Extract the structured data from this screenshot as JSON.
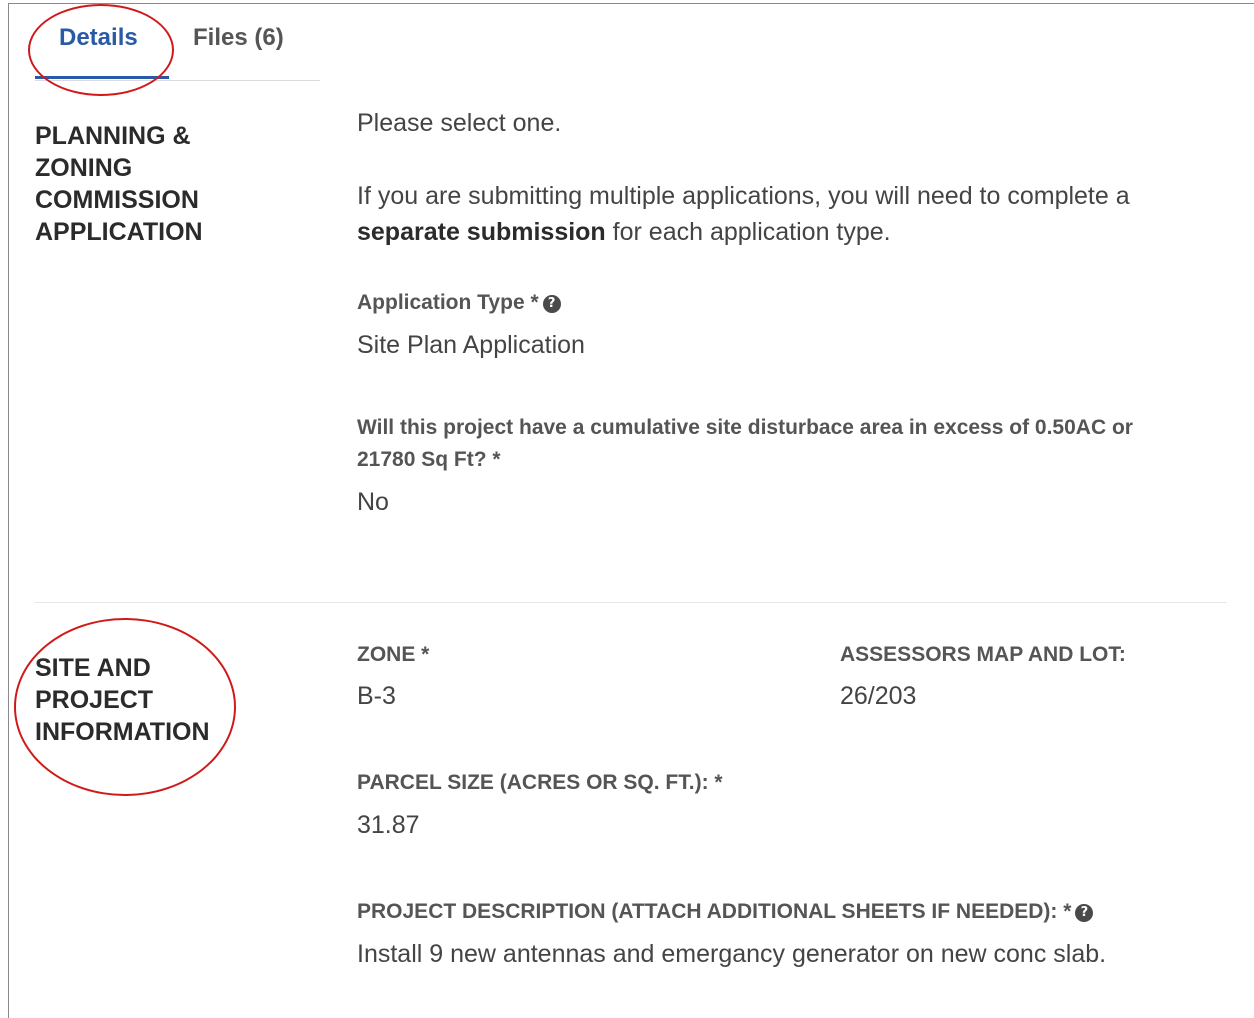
{
  "tabs": {
    "details": "Details",
    "files": "Files (6)"
  },
  "section1": {
    "title": "PLANNING &\nZONING\nCOMMISSION\nAPPLICATION",
    "intro": "Please select one.",
    "note_pre": "If you are submitting multiple applications, you will need to complete a",
    "note_bold": "separate submission",
    "note_post": " for each application type.",
    "app_type_label": "Application Type *",
    "app_type_value": "Site Plan Application",
    "disturb_label_1": "Will this project have a cumulative site disturbace area in excess of 0.50AC or",
    "disturb_label_2": "21780 Sq Ft? *",
    "disturb_value": "No"
  },
  "section2": {
    "title": "SITE AND\nPROJECT\nINFORMATION",
    "zone_label": "ZONE *",
    "zone_value": "B-3",
    "map_lot_label": "ASSESSORS MAP AND LOT:",
    "map_lot_value": "26/203",
    "parcel_label": "PARCEL SIZE (ACRES OR SQ. FT.): *",
    "parcel_value": "31.87",
    "desc_label": "PROJECT DESCRIPTION (ATTACH ADDITIONAL SHEETS IF NEEDED): *",
    "desc_value": "Install 9 new antennas and emergancy generator on new conc slab."
  },
  "icons": {
    "help": "question-circle-icon"
  },
  "colors": {
    "accent": "#2a5aa6",
    "annotation": "#d01a1a"
  }
}
